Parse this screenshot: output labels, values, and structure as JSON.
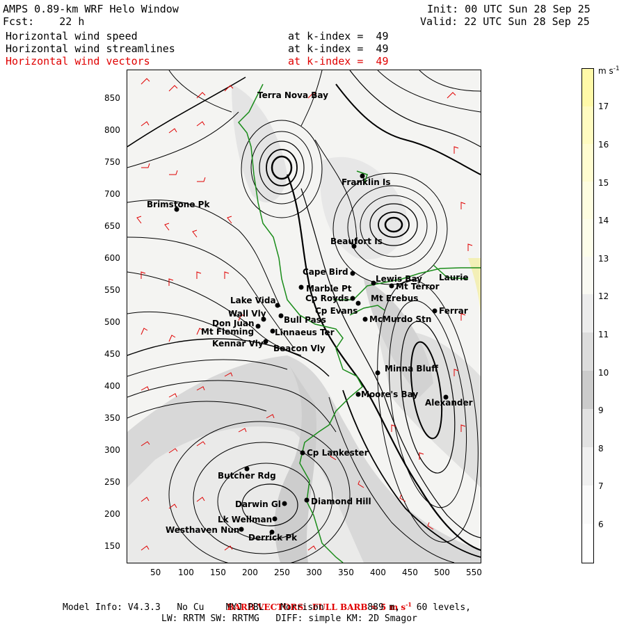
{
  "header": {
    "title": "AMPS 0.89-km WRF Helo Window",
    "forecast": "Fcst:    22 h",
    "init": "Init: 00 UTC Sun 28 Sep 25",
    "valid": "Valid: 22 UTC Sun 28 Sep 25",
    "fields": [
      {
        "name": "Horizontal wind speed",
        "level": "at k-index =  49"
      },
      {
        "name": "Horizontal wind streamlines",
        "level": "at k-index =  49"
      },
      {
        "name": "Horizontal wind vectors",
        "level": "at k-index =  49"
      }
    ]
  },
  "map": {
    "x_ticks": [
      "50",
      "100",
      "150",
      "200",
      "250",
      "300",
      "350",
      "400",
      "450",
      "500",
      "550"
    ],
    "y_ticks": [
      "850",
      "800",
      "750",
      "700",
      "650",
      "600",
      "550",
      "500",
      "450",
      "400",
      "350",
      "300",
      "250",
      "200",
      "150"
    ],
    "places": [
      {
        "name": "Terra Nova Bay"
      },
      {
        "name": "Franklin Is"
      },
      {
        "name": "Brimstone Pk"
      },
      {
        "name": "Beaufort Is"
      },
      {
        "name": "Cape Bird"
      },
      {
        "name": "Lewis Bay"
      },
      {
        "name": "Laurie"
      },
      {
        "name": "Marble Pt"
      },
      {
        "name": "Mt Terror"
      },
      {
        "name": "Cp Royds"
      },
      {
        "name": "Mt Erebus"
      },
      {
        "name": "Lake Vida"
      },
      {
        "name": "Cp Evans"
      },
      {
        "name": "Ferrar"
      },
      {
        "name": "Wall Vly"
      },
      {
        "name": "Bull Pass"
      },
      {
        "name": "McMurdo Stn"
      },
      {
        "name": "Don Juan"
      },
      {
        "name": "Linnaeus Ter"
      },
      {
        "name": "Mt Fleming"
      },
      {
        "name": "Kennar Vly"
      },
      {
        "name": "Beacon Vly"
      },
      {
        "name": "Minna Bluff"
      },
      {
        "name": "Moore's Bay"
      },
      {
        "name": "Alexander"
      },
      {
        "name": "Cp Lankester"
      },
      {
        "name": "Butcher Rdg"
      },
      {
        "name": "Darwin Gl"
      },
      {
        "name": "Diamond Hill"
      },
      {
        "name": "Lk Wellman"
      },
      {
        "name": "Westhaven Nun"
      },
      {
        "name": "Derrick Pk"
      }
    ]
  },
  "colorbar": {
    "unit": "m s",
    "unit_exp": "-1",
    "labels": [
      "17",
      "16",
      "15",
      "14",
      "13",
      "12",
      "11",
      "10",
      "9",
      "8",
      "7",
      "6"
    ],
    "colors": [
      "#fff9a8",
      "#fffbc0",
      "#fffcd0",
      "#fefde0",
      "#fdfdea",
      "#f9f9f2",
      "#ececec",
      "#dcdcdc",
      "#cbcbcb",
      "#e2e2e2",
      "#f0f0f0",
      "#fafafa",
      "#ffffff"
    ]
  },
  "footer": {
    "barb_note": "BARB VECTORS:  FULL BARB = 5 m s",
    "barb_exp": "-1",
    "model_info": "Model Info: V4.3.3   No Cu    MYJ PBL   Morrison        889 m,   60 levels,",
    "physics": "LW: RRTM SW: RRTMG   DIFF: simple KM: 2D Smagor"
  }
}
